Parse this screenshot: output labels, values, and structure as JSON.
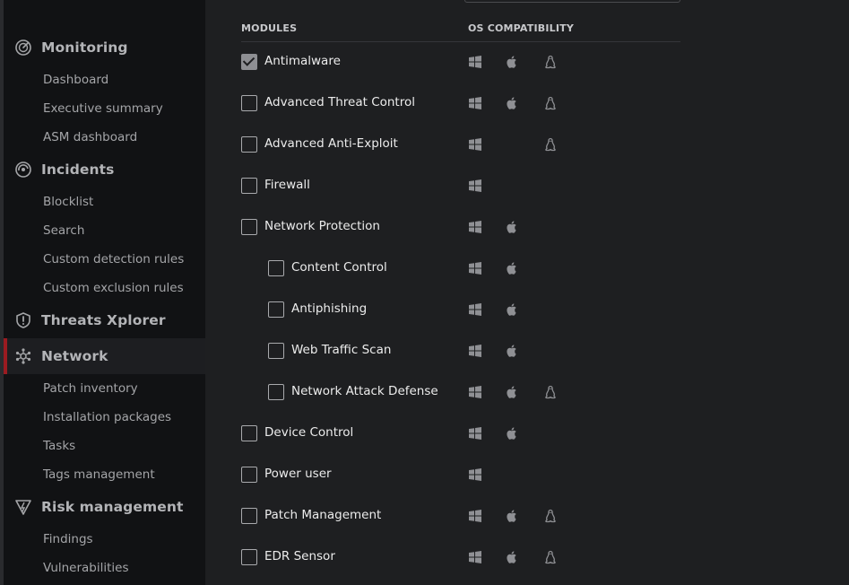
{
  "sidebar": {
    "sections": [
      {
        "label": "Monitoring",
        "icon": "monitoring-icon",
        "items": [
          "Dashboard",
          "Executive summary",
          "ASM dashboard"
        ]
      },
      {
        "label": "Incidents",
        "icon": "incidents-icon",
        "items": [
          "Blocklist",
          "Search",
          "Custom detection rules",
          "Custom exclusion rules"
        ]
      },
      {
        "label": "Threats Xplorer",
        "icon": "shield-icon",
        "items": []
      },
      {
        "label": "Network",
        "icon": "network-icon",
        "active": true,
        "items": [
          "Patch inventory",
          "Installation packages",
          "Tasks",
          "Tags management"
        ]
      },
      {
        "label": "Risk management",
        "icon": "risk-management-icon",
        "items": [
          "Findings",
          "Vulnerabilities"
        ]
      }
    ],
    "active_color": "#9b1b21"
  },
  "main": {
    "columns": {
      "modules": "MODULES",
      "os": "OS COMPATIBILITY"
    },
    "modules": [
      {
        "label": "Antimalware",
        "checked": true,
        "indent": false,
        "windows": true,
        "mac": true,
        "linux": true
      },
      {
        "label": "Advanced Threat Control",
        "checked": false,
        "indent": false,
        "windows": true,
        "mac": true,
        "linux": true
      },
      {
        "label": "Advanced Anti-Exploit",
        "checked": false,
        "indent": false,
        "windows": true,
        "mac": false,
        "linux": true
      },
      {
        "label": "Firewall",
        "checked": false,
        "indent": false,
        "windows": true,
        "mac": false,
        "linux": false
      },
      {
        "label": "Network Protection",
        "checked": false,
        "indent": false,
        "windows": true,
        "mac": true,
        "linux": false
      },
      {
        "label": "Content Control",
        "checked": false,
        "indent": true,
        "windows": true,
        "mac": true,
        "linux": false
      },
      {
        "label": "Antiphishing",
        "checked": false,
        "indent": true,
        "windows": true,
        "mac": true,
        "linux": false
      },
      {
        "label": "Web Traffic Scan",
        "checked": false,
        "indent": true,
        "windows": true,
        "mac": true,
        "linux": false
      },
      {
        "label": "Network Attack Defense",
        "checked": false,
        "indent": true,
        "windows": true,
        "mac": true,
        "linux": true
      },
      {
        "label": "Device Control",
        "checked": false,
        "indent": false,
        "windows": true,
        "mac": true,
        "linux": false
      },
      {
        "label": "Power user",
        "checked": false,
        "indent": false,
        "windows": true,
        "mac": false,
        "linux": false
      },
      {
        "label": "Patch Management",
        "checked": false,
        "indent": false,
        "windows": true,
        "mac": true,
        "linux": true
      },
      {
        "label": "EDR Sensor",
        "checked": false,
        "indent": false,
        "windows": true,
        "mac": true,
        "linux": true
      }
    ]
  }
}
